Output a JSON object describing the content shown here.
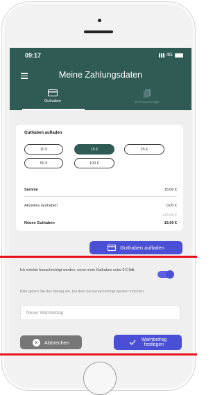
{
  "status": {
    "time": "09:17",
    "network": "4G"
  },
  "header": {
    "title": "Meine Zahlungsdaten"
  },
  "tabs": [
    {
      "label": "Guthaben",
      "icon": "card-icon",
      "active": true
    },
    {
      "label": "Kontoauszüge",
      "icon": "documents-icon",
      "active": false
    }
  ],
  "topup": {
    "title": "Guthaben aufladen",
    "amounts": [
      "10 €",
      "15 €",
      "25 €",
      "50 €",
      "100 €"
    ],
    "selected": "15 €",
    "summary": {
      "sum_label": "Summe",
      "sum_value": "15,00 €",
      "current_label": "Aktuelles Guthaben",
      "current_value": "0,00 €",
      "added_value": "+15,00 €",
      "new_label": "Neues Guthaben",
      "new_value": "15,00 €"
    },
    "button_label": "Guthaben aufladen"
  },
  "warning": {
    "notify_text": "Ich möchte benachrichtigt werden, wenn mein Guthaben unter 0 € fällt.",
    "toggle_on": true,
    "hint_text": "Bitte geben Sie den Betrag ein, bei dem Sie benachrichtigt werden möchten.",
    "input_placeholder": "Neuer Warnbetrag",
    "cancel_label": "Abbrechen",
    "set_label_line1": "Warnbetrag",
    "set_label_line2": "festlegen"
  },
  "colors": {
    "header": "#2f5b54",
    "accent": "#4b4fd6",
    "cancel": "#777777",
    "highlight": "#e8111b"
  }
}
